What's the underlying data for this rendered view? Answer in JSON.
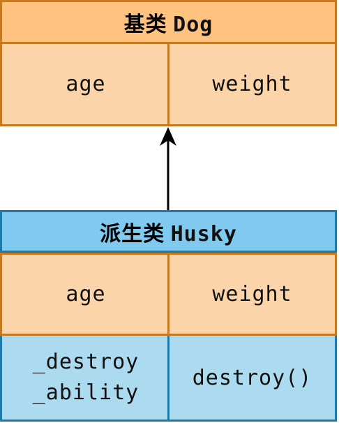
{
  "base_class": {
    "title_prefix": "基类",
    "title_name": "Dog",
    "fields": [
      "age",
      "weight"
    ]
  },
  "derived_class": {
    "title_prefix": "派生类",
    "title_name": "Husky",
    "inherited_fields": [
      "age",
      "weight"
    ],
    "own_member": [
      "_destroy",
      "_ability"
    ],
    "own_method": "destroy()"
  },
  "colors": {
    "base_title_fill": "#ffc27f",
    "field_fill": "#fbd5a9",
    "base_border": "#c57a1f",
    "derived_title_fill": "#80c9ef",
    "derived_own_fill": "#acdaef",
    "derived_border": "#1e7aa8",
    "arrow": "#000000"
  }
}
